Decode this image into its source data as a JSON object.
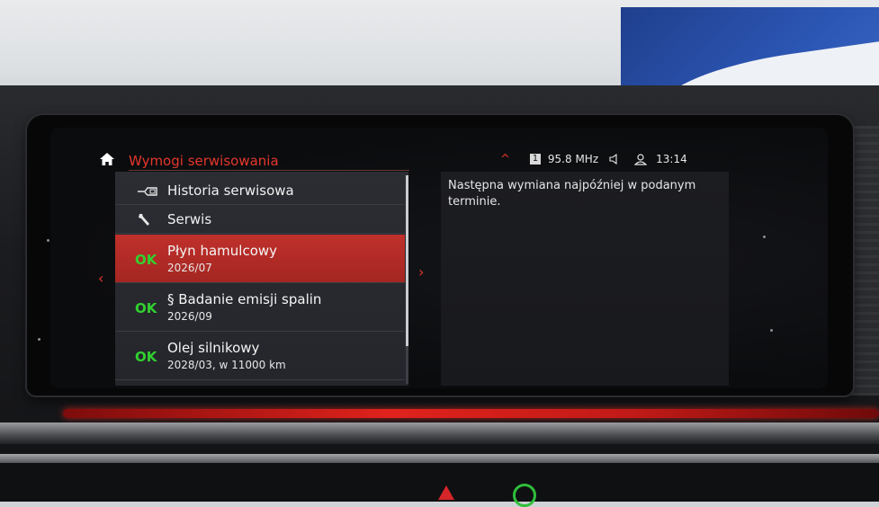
{
  "header": {
    "title": "Wymogi serwisowania"
  },
  "status": {
    "chevron": "^",
    "preset": "1",
    "frequency": "95.8 MHz",
    "time": "13:14"
  },
  "menu": {
    "history_label": "Historia serwisowa",
    "service_label": "Serwis"
  },
  "items": [
    {
      "status": "OK",
      "name": "Płyn hamulcowy",
      "detail": "2026/07"
    },
    {
      "status": "OK",
      "name": "§ Badanie emisji spalin",
      "detail": "2026/09"
    },
    {
      "status": "OK",
      "name": "Olej silnikowy",
      "detail": "2028/03, w 11000 km"
    }
  ],
  "nav": {
    "left": "‹",
    "right": "›"
  },
  "detail": {
    "text": "Następna wymiana najpóźniej w podanym terminie."
  },
  "colors": {
    "accent": "#e4372d",
    "ok": "#31d12f",
    "selected_row": "#b02a25"
  },
  "icons": {
    "home": "home-icon",
    "history": "car-key-icon",
    "service": "wrench-icon",
    "speaker": "speaker-icon",
    "profile": "person-icon"
  }
}
